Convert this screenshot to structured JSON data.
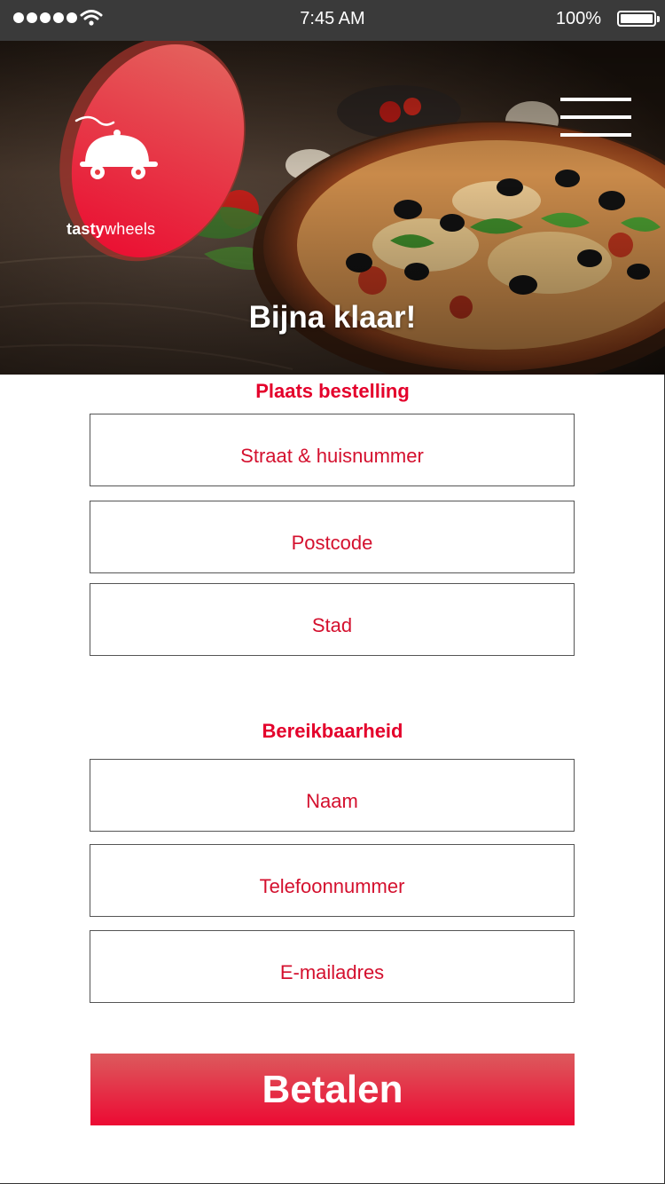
{
  "status_bar": {
    "time": "7:45 AM",
    "battery": "100%",
    "signal_icon": "signal-dots-icon",
    "wifi_icon": "wifi-icon",
    "battery_icon": "battery-icon"
  },
  "hero": {
    "logo_bold": "tasty",
    "logo_light": "wheels",
    "title": "Bijna klaar!",
    "menu_icon": "hamburger-menu-icon"
  },
  "order_section": {
    "title": "Plaats bestelling",
    "street_placeholder": "Straat & huisnummer",
    "postcode_placeholder": "Postcode",
    "city_placeholder": "Stad"
  },
  "contact_section": {
    "title": "Bereikbaarheid",
    "name_placeholder": "Naam",
    "phone_placeholder": "Telefoonnummer",
    "email_placeholder": "E-mailadres"
  },
  "pay_button": {
    "label": "Betalen"
  },
  "colors": {
    "accent": "#e4002b",
    "status_bar": "#3a3a3a"
  }
}
